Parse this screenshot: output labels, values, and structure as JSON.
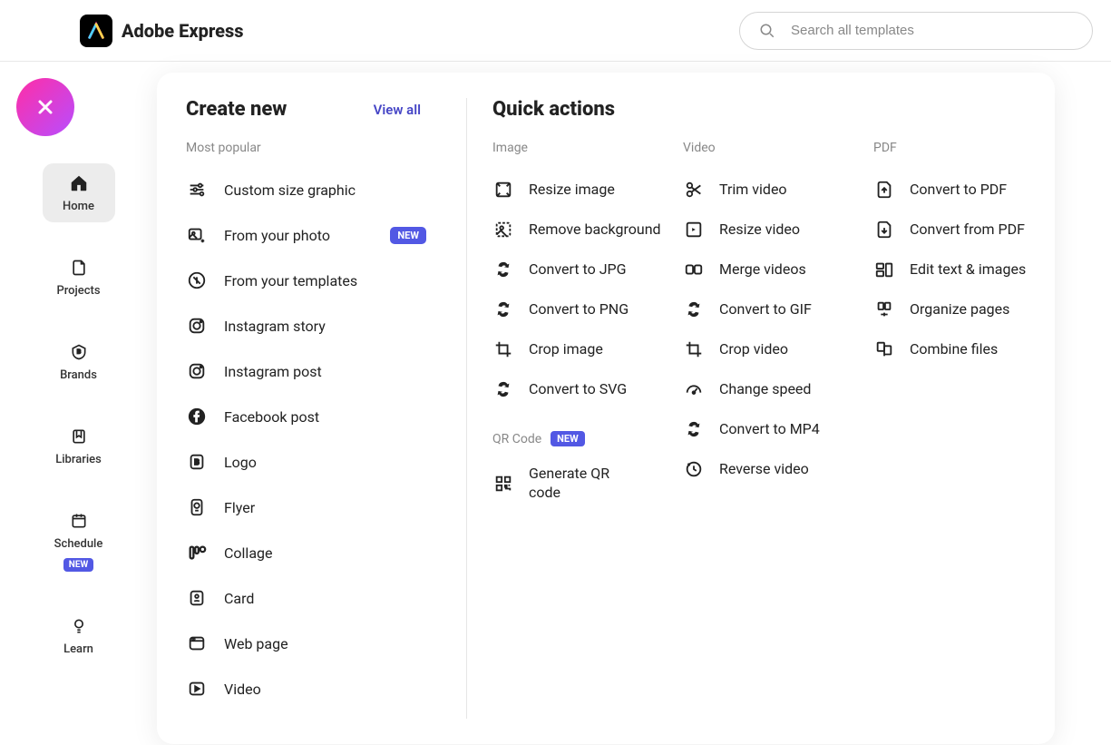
{
  "header": {
    "app_name": "Adobe Express",
    "search_placeholder": "Search all templates"
  },
  "sidebar": {
    "items": [
      {
        "label": "Home"
      },
      {
        "label": "Projects"
      },
      {
        "label": "Brands"
      },
      {
        "label": "Libraries"
      },
      {
        "label": "Schedule",
        "badge": "NEW"
      },
      {
        "label": "Learn"
      }
    ]
  },
  "create": {
    "title": "Create new",
    "view_all": "View all",
    "subhead": "Most popular",
    "items": [
      {
        "label": "Custom size graphic"
      },
      {
        "label": "From your photo",
        "badge": "NEW"
      },
      {
        "label": "From your templates"
      },
      {
        "label": "Instagram story"
      },
      {
        "label": "Instagram post"
      },
      {
        "label": "Facebook post"
      },
      {
        "label": "Logo"
      },
      {
        "label": "Flyer"
      },
      {
        "label": "Collage"
      },
      {
        "label": "Card"
      },
      {
        "label": "Web page"
      },
      {
        "label": "Video"
      }
    ]
  },
  "quick": {
    "title": "Quick actions",
    "columns": [
      {
        "heading": "Image",
        "items": [
          {
            "label": "Resize image"
          },
          {
            "label": "Remove background"
          },
          {
            "label": "Convert to JPG"
          },
          {
            "label": "Convert to PNG"
          },
          {
            "label": "Crop image"
          },
          {
            "label": "Convert to SVG"
          }
        ],
        "extra_heading": "QR Code",
        "extra_badge": "NEW",
        "extra_items": [
          {
            "label": "Generate QR code"
          }
        ]
      },
      {
        "heading": "Video",
        "items": [
          {
            "label": "Trim video"
          },
          {
            "label": "Resize video"
          },
          {
            "label": "Merge videos"
          },
          {
            "label": "Convert to GIF"
          },
          {
            "label": "Crop video"
          },
          {
            "label": "Change speed"
          },
          {
            "label": "Convert to MP4"
          },
          {
            "label": "Reverse video"
          }
        ]
      },
      {
        "heading": "PDF",
        "items": [
          {
            "label": "Convert to PDF"
          },
          {
            "label": "Convert from PDF"
          },
          {
            "label": "Edit text & images"
          },
          {
            "label": "Organize pages"
          },
          {
            "label": "Combine files"
          }
        ]
      }
    ]
  }
}
